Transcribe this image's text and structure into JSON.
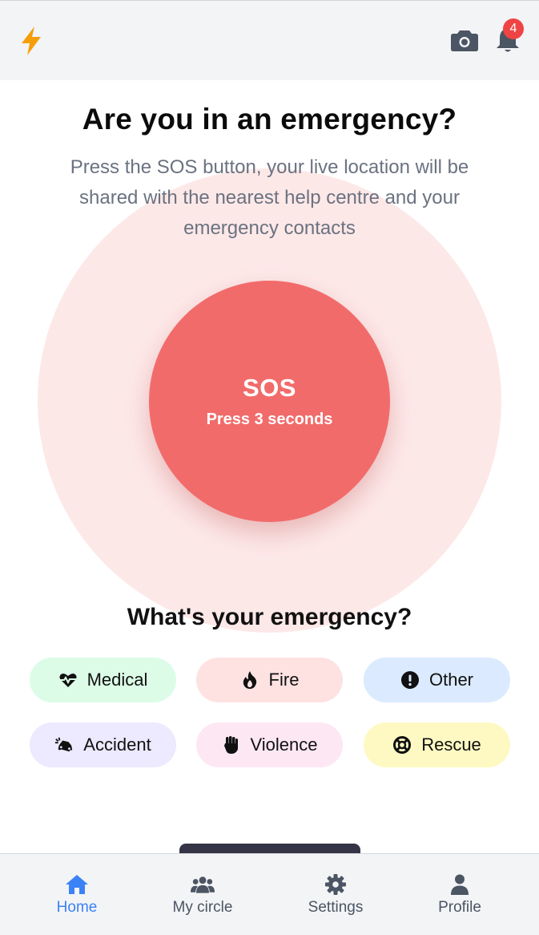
{
  "colors": {
    "accent": "#3b82f6",
    "sos": "#f26b6b",
    "sos_ring": "#fde8e8",
    "badge": "#ef4444",
    "logo": "#f59e0b"
  },
  "topbar": {
    "logo_icon": "lightning-bolt-icon",
    "camera_icon": "camera-icon",
    "bell_icon": "bell-icon",
    "notification_count": "4"
  },
  "hero": {
    "title": "Are you in an emergency?",
    "subtitle": "Press the SOS button, your live location will be shared with the nearest help centre and your emergency contacts"
  },
  "sos": {
    "label": "SOS",
    "hint": "Press 3 seconds"
  },
  "emergency": {
    "heading": "What's your emergency?",
    "types": [
      {
        "label": "Medical",
        "icon": "heart-pulse-icon",
        "color": "#dcfce7"
      },
      {
        "label": "Fire",
        "icon": "fire-icon",
        "color": "#fee2e2"
      },
      {
        "label": "Other",
        "icon": "exclamation-circle-icon",
        "color": "#dbeafe"
      },
      {
        "label": "Accident",
        "icon": "car-crash-icon",
        "color": "#ede9fe"
      },
      {
        "label": "Violence",
        "icon": "fist-icon",
        "color": "#fce7f3"
      },
      {
        "label": "Rescue",
        "icon": "lifebuoy-icon",
        "color": "#fef9c3"
      }
    ]
  },
  "nav": {
    "items": [
      {
        "label": "Home",
        "icon": "home-icon",
        "active": true
      },
      {
        "label": "My circle",
        "icon": "group-icon",
        "active": false
      },
      {
        "label": "Settings",
        "icon": "gear-icon",
        "active": false
      },
      {
        "label": "Profile",
        "icon": "user-icon",
        "active": false
      }
    ]
  }
}
